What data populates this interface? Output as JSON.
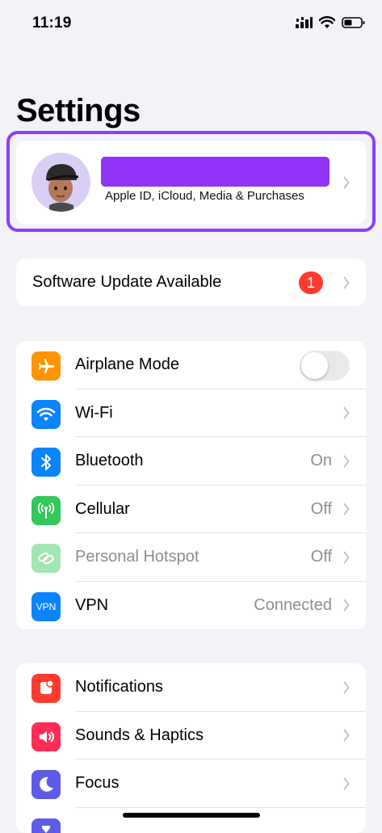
{
  "status_bar": {
    "time": "11:19"
  },
  "page": {
    "title": "Settings"
  },
  "profile": {
    "subtitle": "Apple ID, iCloud, Media & Purchases",
    "redaction_color": "#9134f7",
    "highlight_color": "#8a3ffc"
  },
  "software_update": {
    "label": "Software Update Available",
    "badge_count": "1"
  },
  "connectivity": {
    "airplane_mode": {
      "label": "Airplane Mode",
      "icon": "airplane-icon",
      "color": "#ff9500",
      "enabled": false
    },
    "wifi": {
      "label": "Wi-Fi",
      "icon": "wifi-icon",
      "color": "#0a84ff"
    },
    "bluetooth": {
      "label": "Bluetooth",
      "value": "On",
      "icon": "bluetooth-icon",
      "color": "#0a84ff"
    },
    "cellular": {
      "label": "Cellular",
      "value": "Off",
      "icon": "antenna-icon",
      "color": "#34c759"
    },
    "hotspot": {
      "label": "Personal Hotspot",
      "value": "Off",
      "icon": "link-icon",
      "color": "#34c759"
    },
    "vpn": {
      "label": "VPN",
      "value": "Connected",
      "icon_text": "VPN",
      "color": "#0a84ff"
    }
  },
  "general": {
    "notifications": {
      "label": "Notifications",
      "icon": "bell-icon",
      "color": "#ff3b30"
    },
    "sounds": {
      "label": "Sounds & Haptics",
      "icon": "speaker-icon",
      "color": "#ff2d55"
    },
    "focus": {
      "label": "Focus",
      "icon": "moon-icon",
      "color": "#5e5ce6"
    },
    "screen_time": {
      "icon": "hourglass-icon",
      "color": "#5e5ce6"
    }
  }
}
